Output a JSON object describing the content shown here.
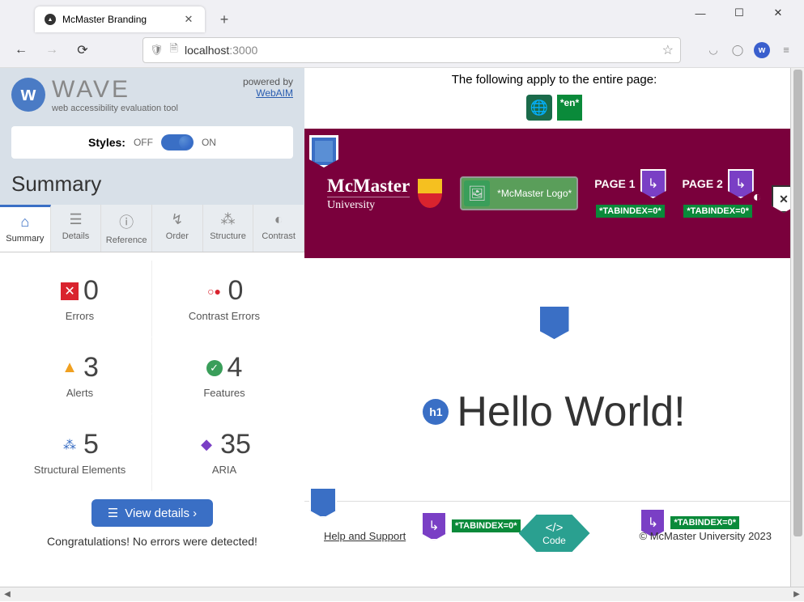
{
  "browser": {
    "tab_title": "McMaster Branding",
    "url_host": "localhost",
    "url_port": ":3000"
  },
  "wave": {
    "brand": "WAVE",
    "tagline": "web accessibility evaluation tool",
    "powered_label": "powered by",
    "powered_link": "WebAIM",
    "styles_label": "Styles:",
    "off": "OFF",
    "on": "ON",
    "summary_title": "Summary",
    "tabs": {
      "summary": "Summary",
      "details": "Details",
      "reference": "Reference",
      "order": "Order",
      "structure": "Structure",
      "contrast": "Contrast"
    },
    "stats": {
      "errors": {
        "value": "0",
        "label": "Errors"
      },
      "contrast": {
        "value": "0",
        "label": "Contrast Errors"
      },
      "alerts": {
        "value": "3",
        "label": "Alerts"
      },
      "features": {
        "value": "4",
        "label": "Features"
      },
      "structural": {
        "value": "5",
        "label": "Structural Elements"
      },
      "aria": {
        "value": "35",
        "label": "ARIA"
      }
    },
    "view_details": "View details ›",
    "congrats": "Congratulations! No errors were detected!"
  },
  "page": {
    "notice": "The following apply to the entire page:",
    "lang_value": "*en*",
    "mcmaster_name": "McMaster",
    "mcmaster_univ": "University",
    "img_alt": "*McMaster Logo*",
    "nav1": "PAGE 1",
    "nav2": "PAGE 2",
    "tabindex": "*TABINDEX=0*",
    "h1_badge": "h1",
    "hello": "Hello World!",
    "help_link": "Help and Support",
    "copyright": "© McMaster University 2023",
    "code_icon": "</>",
    "code_label": "Code"
  }
}
